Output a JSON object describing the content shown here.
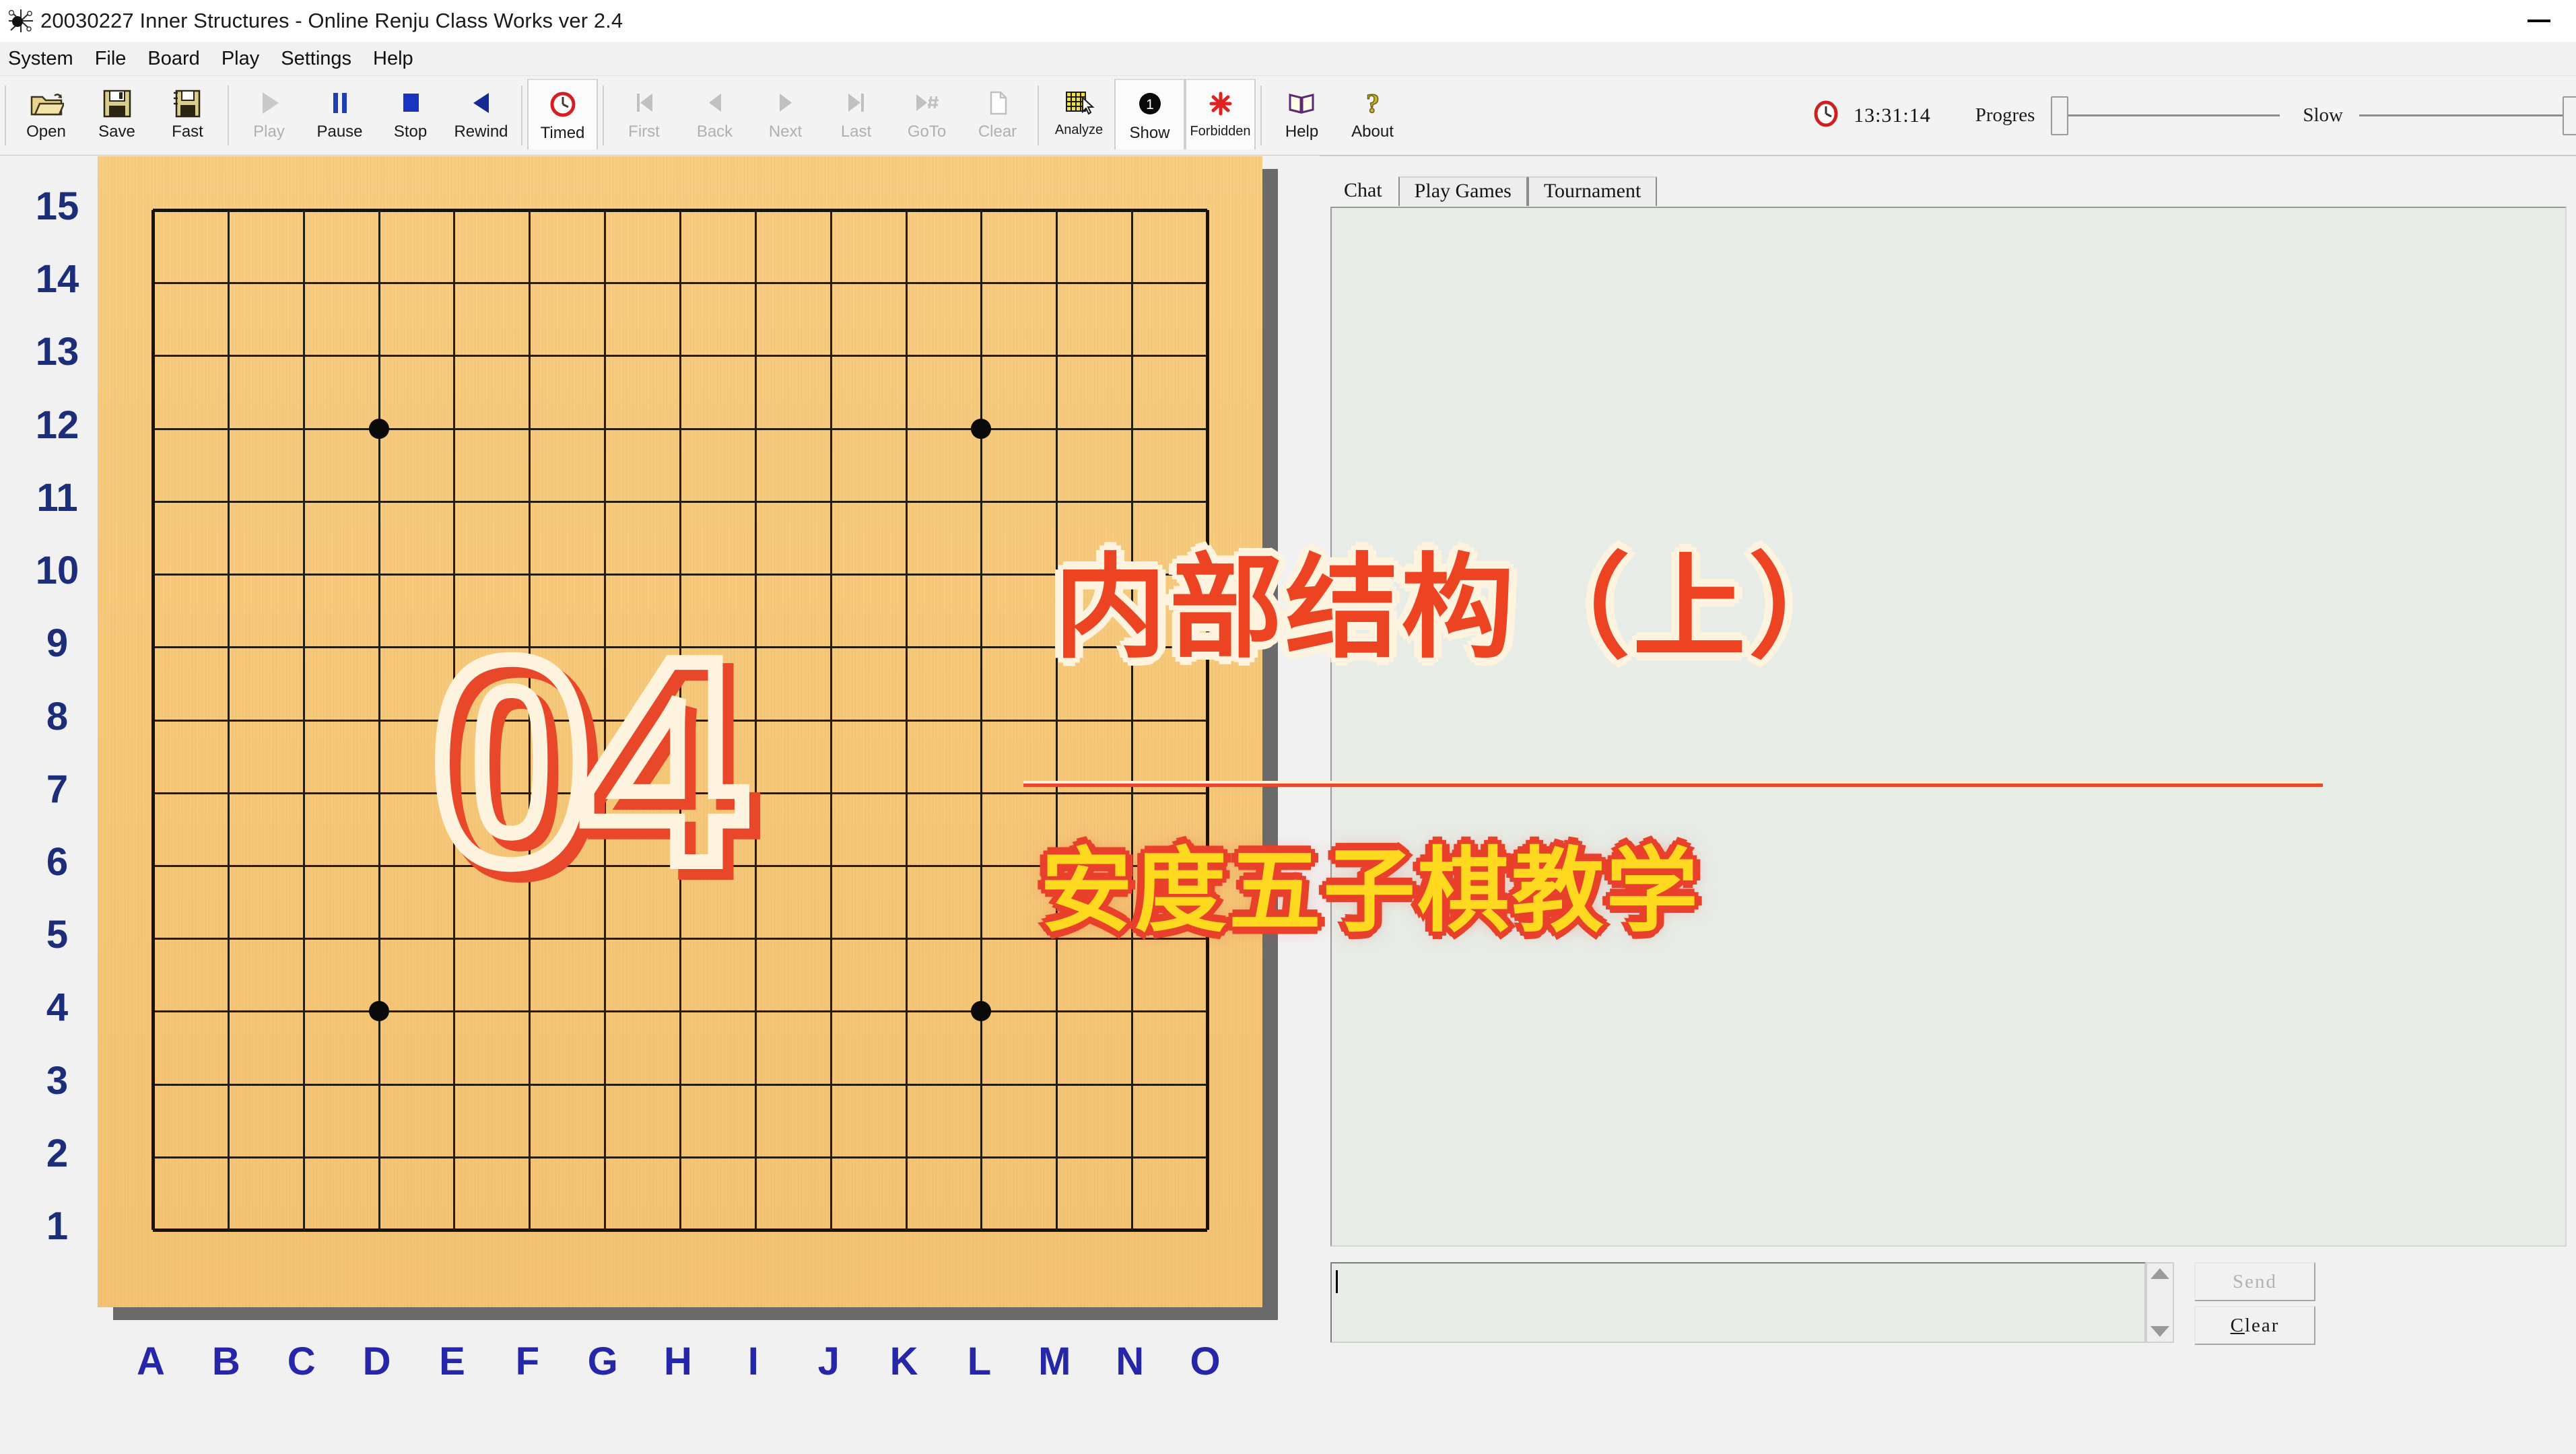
{
  "window": {
    "title": "20030227 Inner Structures  - Online Renju Class Works ver 2.4",
    "app_icon": "renju-app-icon",
    "minimize_label": "—"
  },
  "menu": {
    "items": [
      {
        "label": "System"
      },
      {
        "label": "File"
      },
      {
        "label": "Board"
      },
      {
        "label": "Play"
      },
      {
        "label": "Settings"
      },
      {
        "label": "Help"
      }
    ]
  },
  "toolbar": {
    "groups": [
      {
        "name": "file",
        "buttons": [
          {
            "label": "Open",
            "icon": "open-folder-icon",
            "enabled": true,
            "active": false
          },
          {
            "label": "Save",
            "icon": "floppy-save-icon",
            "enabled": true,
            "active": false
          },
          {
            "label": "Fast",
            "icon": "floppy-fast-icon",
            "enabled": true,
            "active": false
          }
        ]
      },
      {
        "name": "playback",
        "buttons": [
          {
            "label": "Play",
            "icon": "play-triangle-icon",
            "enabled": false,
            "active": false
          },
          {
            "label": "Pause",
            "icon": "pause-bars-icon",
            "enabled": true,
            "active": false
          },
          {
            "label": "Stop",
            "icon": "stop-square-icon",
            "enabled": true,
            "active": false
          },
          {
            "label": "Rewind",
            "icon": "rewind-triangle-icon",
            "enabled": true,
            "active": false
          }
        ]
      },
      {
        "name": "timed",
        "buttons": [
          {
            "label": "Timed",
            "icon": "red-clock-icon",
            "enabled": true,
            "active": true
          }
        ]
      },
      {
        "name": "navigation",
        "buttons": [
          {
            "label": "First",
            "icon": "skip-first-icon",
            "enabled": false,
            "active": false
          },
          {
            "label": "Back",
            "icon": "step-back-icon",
            "enabled": false,
            "active": false
          },
          {
            "label": "Next",
            "icon": "step-next-icon",
            "enabled": false,
            "active": false
          },
          {
            "label": "Last",
            "icon": "skip-last-icon",
            "enabled": false,
            "active": false
          },
          {
            "label": "GoTo",
            "icon": "goto-number-icon",
            "enabled": false,
            "active": false
          },
          {
            "label": "Clear",
            "icon": "blank-page-icon",
            "enabled": false,
            "active": false
          }
        ]
      },
      {
        "name": "analysis",
        "buttons": [
          {
            "label": "Analyze",
            "icon": "grid-cursor-icon",
            "enabled": true,
            "active": false
          },
          {
            "label": "Show",
            "icon": "black-stone-1-icon",
            "enabled": true,
            "active": true
          },
          {
            "label": "Forbidden",
            "icon": "red-asterisk-icon",
            "enabled": true,
            "active": true
          }
        ]
      },
      {
        "name": "help",
        "buttons": [
          {
            "label": "Help",
            "icon": "open-book-icon",
            "enabled": true,
            "active": false
          },
          {
            "label": "About",
            "icon": "question-mark-icon",
            "enabled": true,
            "active": false
          }
        ]
      }
    ],
    "clock": {
      "icon": "red-clock-icon",
      "time": "13:31:14"
    },
    "progress": {
      "label": "Progres",
      "value": 0,
      "min": 0,
      "max": 100
    },
    "speed": {
      "label": "Slow",
      "value": 100,
      "min": 0,
      "max": 100
    }
  },
  "board": {
    "size": 15,
    "col_labels": [
      "A",
      "B",
      "C",
      "D",
      "E",
      "F",
      "G",
      "H",
      "I",
      "J",
      "K",
      "L",
      "M",
      "N",
      "O"
    ],
    "row_labels": [
      "15",
      "14",
      "13",
      "12",
      "11",
      "10",
      "9",
      "8",
      "7",
      "6",
      "5",
      "4",
      "3",
      "2",
      "1"
    ],
    "star_points": [
      "D12",
      "L12",
      "H8",
      "D4",
      "L4"
    ],
    "stones": [],
    "colors": {
      "wood": "#f6c87a",
      "line": "#241c0c",
      "label_row": "#1c2d7a",
      "label_col": "#2626a8",
      "shadow": "#6a6a6a"
    }
  },
  "overlay": {
    "episode_number": "04",
    "title_cn": "内部结构（上）",
    "subtitle_cn": "安度五子棋教学",
    "colors": {
      "title_fill": "#ec4323",
      "title_outline": "#fdf3de",
      "subtitle_fill": "#ffd820",
      "subtitle_outline": "#e8402a",
      "number_outline": "#fdf3de",
      "number_shadow": "#e8472a",
      "divider": "#e8472a"
    }
  },
  "chat": {
    "tabs": [
      {
        "label": "Chat",
        "active": true
      },
      {
        "label": "Play Games",
        "active": false
      },
      {
        "label": "Tournament",
        "active": false
      }
    ],
    "log_text": "",
    "input_value": "",
    "send_label": "Send",
    "send_enabled": false,
    "clear_label_prefix": "C",
    "clear_label_rest": "lear",
    "clear_enabled": true,
    "scroll_up_icon": "scroll-up-arrow-icon",
    "scroll_down_icon": "scroll-down-arrow-icon"
  }
}
